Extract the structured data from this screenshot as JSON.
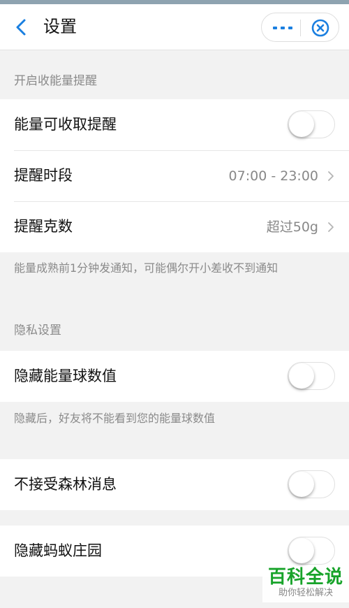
{
  "navbar": {
    "title": "设置",
    "back_icon": "chevron-left-icon",
    "more_icon": "ellipsis-icon",
    "close_icon": "target-close-icon",
    "accent_color": "#1a7fe0"
  },
  "energy_section": {
    "header": "开启收能量提醒",
    "rows": [
      {
        "label": "能量可收取提醒",
        "type": "toggle",
        "enabled": false
      },
      {
        "label": "提醒时段",
        "type": "link",
        "value": "07:00 - 23:00"
      },
      {
        "label": "提醒克数",
        "type": "link",
        "value": "超过50g"
      }
    ],
    "note": "能量成熟前1分钟发通知，可能偶尔开小差收不到通知"
  },
  "privacy_section": {
    "header": "隐私设置",
    "rows": [
      {
        "label": "隐藏能量球数值",
        "type": "toggle",
        "enabled": false
      }
    ],
    "note": "隐藏后，好友将不能看到您的能量球数值"
  },
  "messages_section": {
    "rows": [
      {
        "label": "不接受森林消息",
        "type": "toggle",
        "enabled": false
      }
    ]
  },
  "ant_section": {
    "rows": [
      {
        "label": "隐藏蚂蚁庄园",
        "type": "toggle",
        "enabled": false
      }
    ]
  },
  "watermark": {
    "title": "百科全说",
    "subtitle": "助你轻松解决",
    "color": "#18a32a"
  }
}
